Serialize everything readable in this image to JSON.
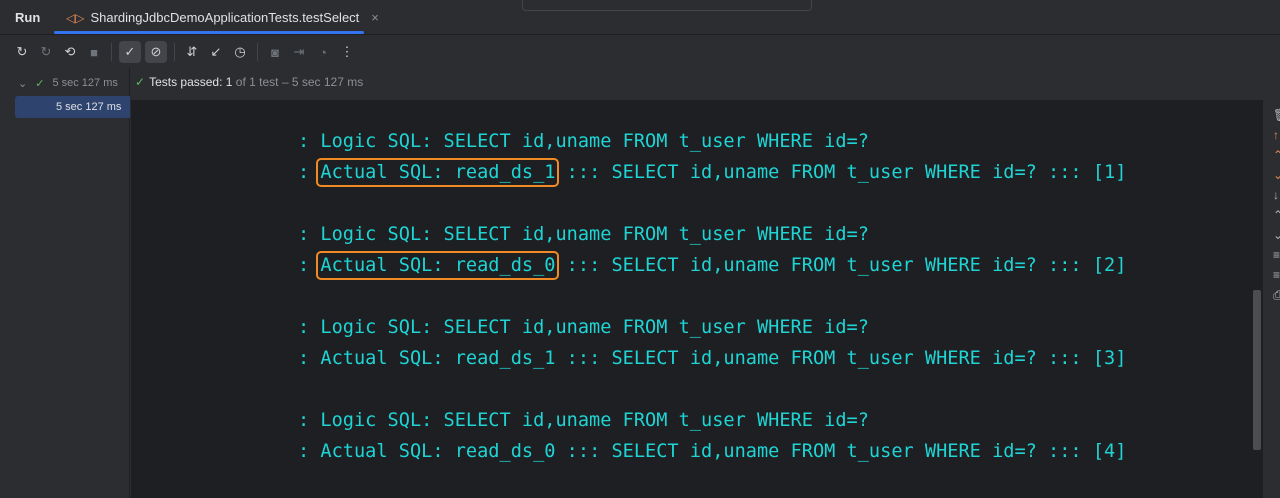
{
  "header": {
    "run_label": "Run",
    "tab_title": "ShardingJdbcDemoApplicationTests.testSelect",
    "close_glyph": "×"
  },
  "toolbar": {
    "icons": [
      "rerun-icon",
      "rerun-failed-icon",
      "toggle-auto-test-icon",
      "stop-icon",
      "show-passed-icon",
      "show-ignored-icon",
      "sort-icon",
      "collapse-icon",
      "history-icon",
      "screenshot-icon",
      "import-icon",
      "coverage-icon",
      "more-icon"
    ]
  },
  "tree": {
    "root_time": "5 sec 127 ms",
    "selected_time": "5 sec 127 ms"
  },
  "status": {
    "prefix": "Tests passed: ",
    "count": "1",
    "suffix": " of 1 test – 5 sec 127 ms"
  },
  "console": {
    "groups": [
      {
        "logic": ": Logic SQL: SELECT id,uname FROM t_user WHERE id=?",
        "actual_prefix": ": ",
        "actual_ds": "Actual SQL: read_ds_1",
        "actual_rest": " ::: SELECT id,uname FROM t_user WHERE id=? ::: [1]",
        "highlighted": true
      },
      {
        "logic": ": Logic SQL: SELECT id,uname FROM t_user WHERE id=?",
        "actual_prefix": ": ",
        "actual_ds": "Actual SQL: read_ds_0",
        "actual_rest": " ::: SELECT id,uname FROM t_user WHERE id=? ::: [2]",
        "highlighted": true
      },
      {
        "logic": ": Logic SQL: SELECT id,uname FROM t_user WHERE id=?",
        "actual_prefix": ": ",
        "actual_ds": "Actual SQL: read_ds_1",
        "actual_rest": " ::: SELECT id,uname FROM t_user WHERE id=? ::: [3]",
        "highlighted": false
      },
      {
        "logic": ": Logic SQL: SELECT id,uname FROM t_user WHERE id=?",
        "actual_prefix": ": ",
        "actual_ds": "Actual SQL: read_ds_0",
        "actual_rest": " ::: SELECT id,uname FROM t_user WHERE id=? ::: [4]",
        "highlighted": false
      }
    ],
    "text_color": "#1fd4d4",
    "highlight_color": "#f08a24"
  }
}
